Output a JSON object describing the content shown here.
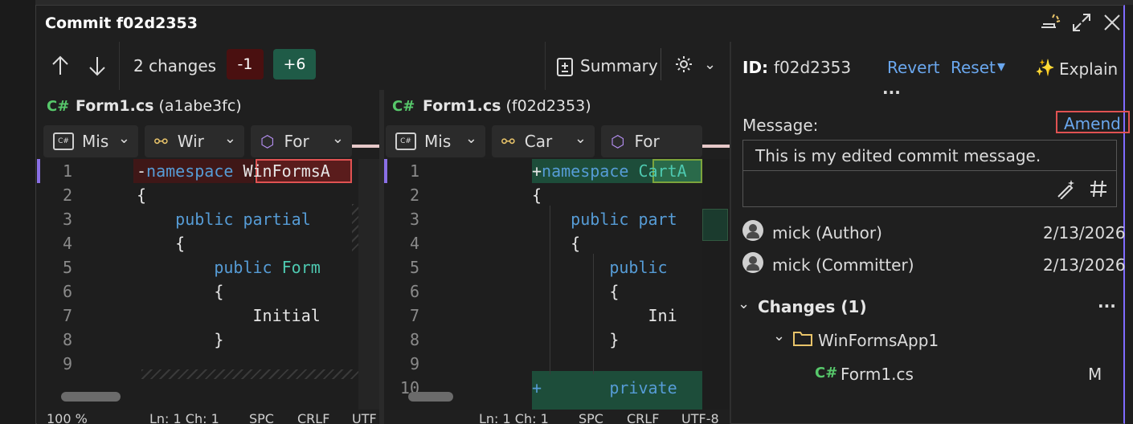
{
  "window": {
    "title": "Commit f02d2353"
  },
  "toolbar": {
    "changes_label": "2 changes",
    "minus_badge": "-1",
    "plus_badge": "+6",
    "summary_label": "Summary"
  },
  "left_pane": {
    "file_name": "Form1.cs",
    "file_hash": "(a1abe3fc)",
    "dropdowns": [
      "Mis",
      "Wir",
      "For"
    ],
    "lines": [
      {
        "num": "1",
        "code": [
          {
            "t": "-",
            "c": "txt"
          },
          {
            "t": "namespace ",
            "c": "kw"
          },
          {
            "t": "WinFormsA",
            "c": "txt"
          }
        ]
      },
      {
        "num": "2",
        "code": [
          {
            "t": "{",
            "c": "txt"
          }
        ]
      },
      {
        "num": "3",
        "code": [
          {
            "t": "    public partial",
            "c": "kw"
          }
        ]
      },
      {
        "num": "4",
        "code": [
          {
            "t": "    {",
            "c": "txt"
          }
        ]
      },
      {
        "num": "5",
        "code": [
          {
            "t": "        public ",
            "c": "kw"
          },
          {
            "t": "Form",
            "c": "ty"
          }
        ]
      },
      {
        "num": "6",
        "code": [
          {
            "t": "        {",
            "c": "txt"
          }
        ]
      },
      {
        "num": "7",
        "code": [
          {
            "t": "            Initial",
            "c": "txt"
          }
        ]
      },
      {
        "num": "8",
        "code": [
          {
            "t": "        }",
            "c": "txt"
          }
        ]
      },
      {
        "num": "9",
        "code": []
      }
    ],
    "status": [
      "100 %",
      "Ln: 1  Ch: 1",
      "SPC",
      "CRLF",
      "UTF"
    ]
  },
  "right_pane": {
    "file_name": "Form1.cs",
    "file_hash": "(f02d2353)",
    "dropdowns": [
      "Mis",
      "Car",
      "For"
    ],
    "lines": [
      {
        "num": "1",
        "code": [
          {
            "t": "+",
            "c": "txt"
          },
          {
            "t": "namespace ",
            "c": "kw"
          },
          {
            "t": "CartA",
            "c": "ty"
          }
        ]
      },
      {
        "num": "2",
        "code": [
          {
            "t": "{",
            "c": "txt"
          }
        ]
      },
      {
        "num": "3",
        "code": [
          {
            "t": "    public part",
            "c": "kw"
          }
        ]
      },
      {
        "num": "4",
        "code": [
          {
            "t": "    {",
            "c": "txt"
          }
        ]
      },
      {
        "num": "5",
        "code": [
          {
            "t": "        public",
            "c": "kw"
          }
        ]
      },
      {
        "num": "6",
        "code": [
          {
            "t": "        {",
            "c": "txt"
          }
        ]
      },
      {
        "num": "7",
        "code": [
          {
            "t": "            Ini",
            "c": "txt"
          }
        ]
      },
      {
        "num": "8",
        "code": [
          {
            "t": "        }",
            "c": "txt"
          }
        ]
      },
      {
        "num": "9",
        "code": []
      },
      {
        "num": "10",
        "code": [
          {
            "t": "+       private",
            "c": "kw"
          }
        ]
      }
    ],
    "status": [
      "Ln: 1  Ch: 1",
      "SPC",
      "CRLF",
      "UTF-8"
    ]
  },
  "details": {
    "id_label": "ID:",
    "id_value": "f02d2353",
    "revert": "Revert",
    "reset": "Reset",
    "explain": "Explain",
    "more": "...",
    "message_label": "Message:",
    "amend": "Amend",
    "message_value": "This is my edited commit message.",
    "author": "mick (Author)",
    "author_date": "2/13/2026",
    "committer": "mick (Committer)",
    "committer_date": "2/13/2026",
    "changes_header": "Changes (1)",
    "changes_more": "...",
    "folder": "WinFormsApp1",
    "file": "Form1.cs",
    "file_status": "M",
    "file_lang": "C#"
  },
  "colors": {
    "accent": "#7f6bff",
    "link": "#6aa7ee",
    "removed_bg": "#4b1818",
    "added_bg": "#1d4d3a",
    "highlight_red": "#e05252"
  }
}
